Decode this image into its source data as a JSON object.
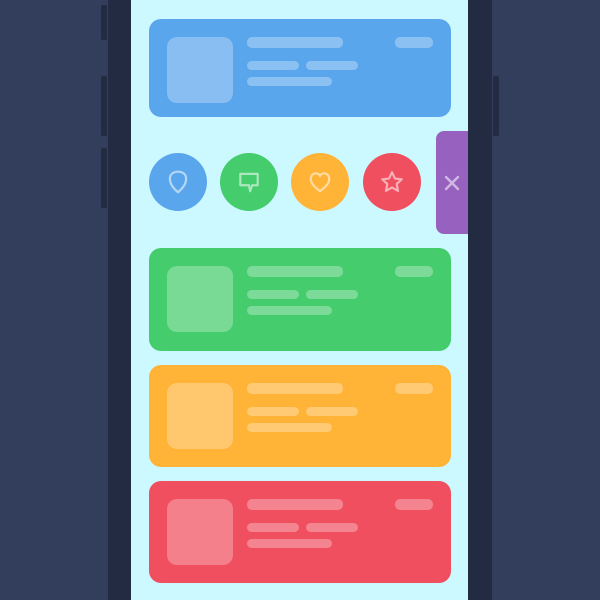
{
  "colors": {
    "background": "#333e5d",
    "phone_frame": "#232b43",
    "screen": "#ccf9ff",
    "blue": "#5aa6ec",
    "green": "#45cc6d",
    "orange": "#ffb337",
    "red": "#f04f5f",
    "purple": "#9762bf",
    "icon_stroke": "rgba(255,255,255,0.55)"
  },
  "cards": [
    {
      "id": "card-blue",
      "color": "blue"
    },
    {
      "id": "card-green",
      "color": "green"
    },
    {
      "id": "card-orange",
      "color": "orange"
    },
    {
      "id": "card-red",
      "color": "red"
    }
  ],
  "actions": [
    {
      "id": "shield",
      "icon": "shield-icon",
      "color": "blue"
    },
    {
      "id": "comment",
      "icon": "comment-icon",
      "color": "green"
    },
    {
      "id": "heart",
      "icon": "heart-icon",
      "color": "orange"
    },
    {
      "id": "star",
      "icon": "star-icon",
      "color": "red"
    }
  ],
  "close_tab": {
    "icon": "close-icon",
    "color": "purple"
  }
}
